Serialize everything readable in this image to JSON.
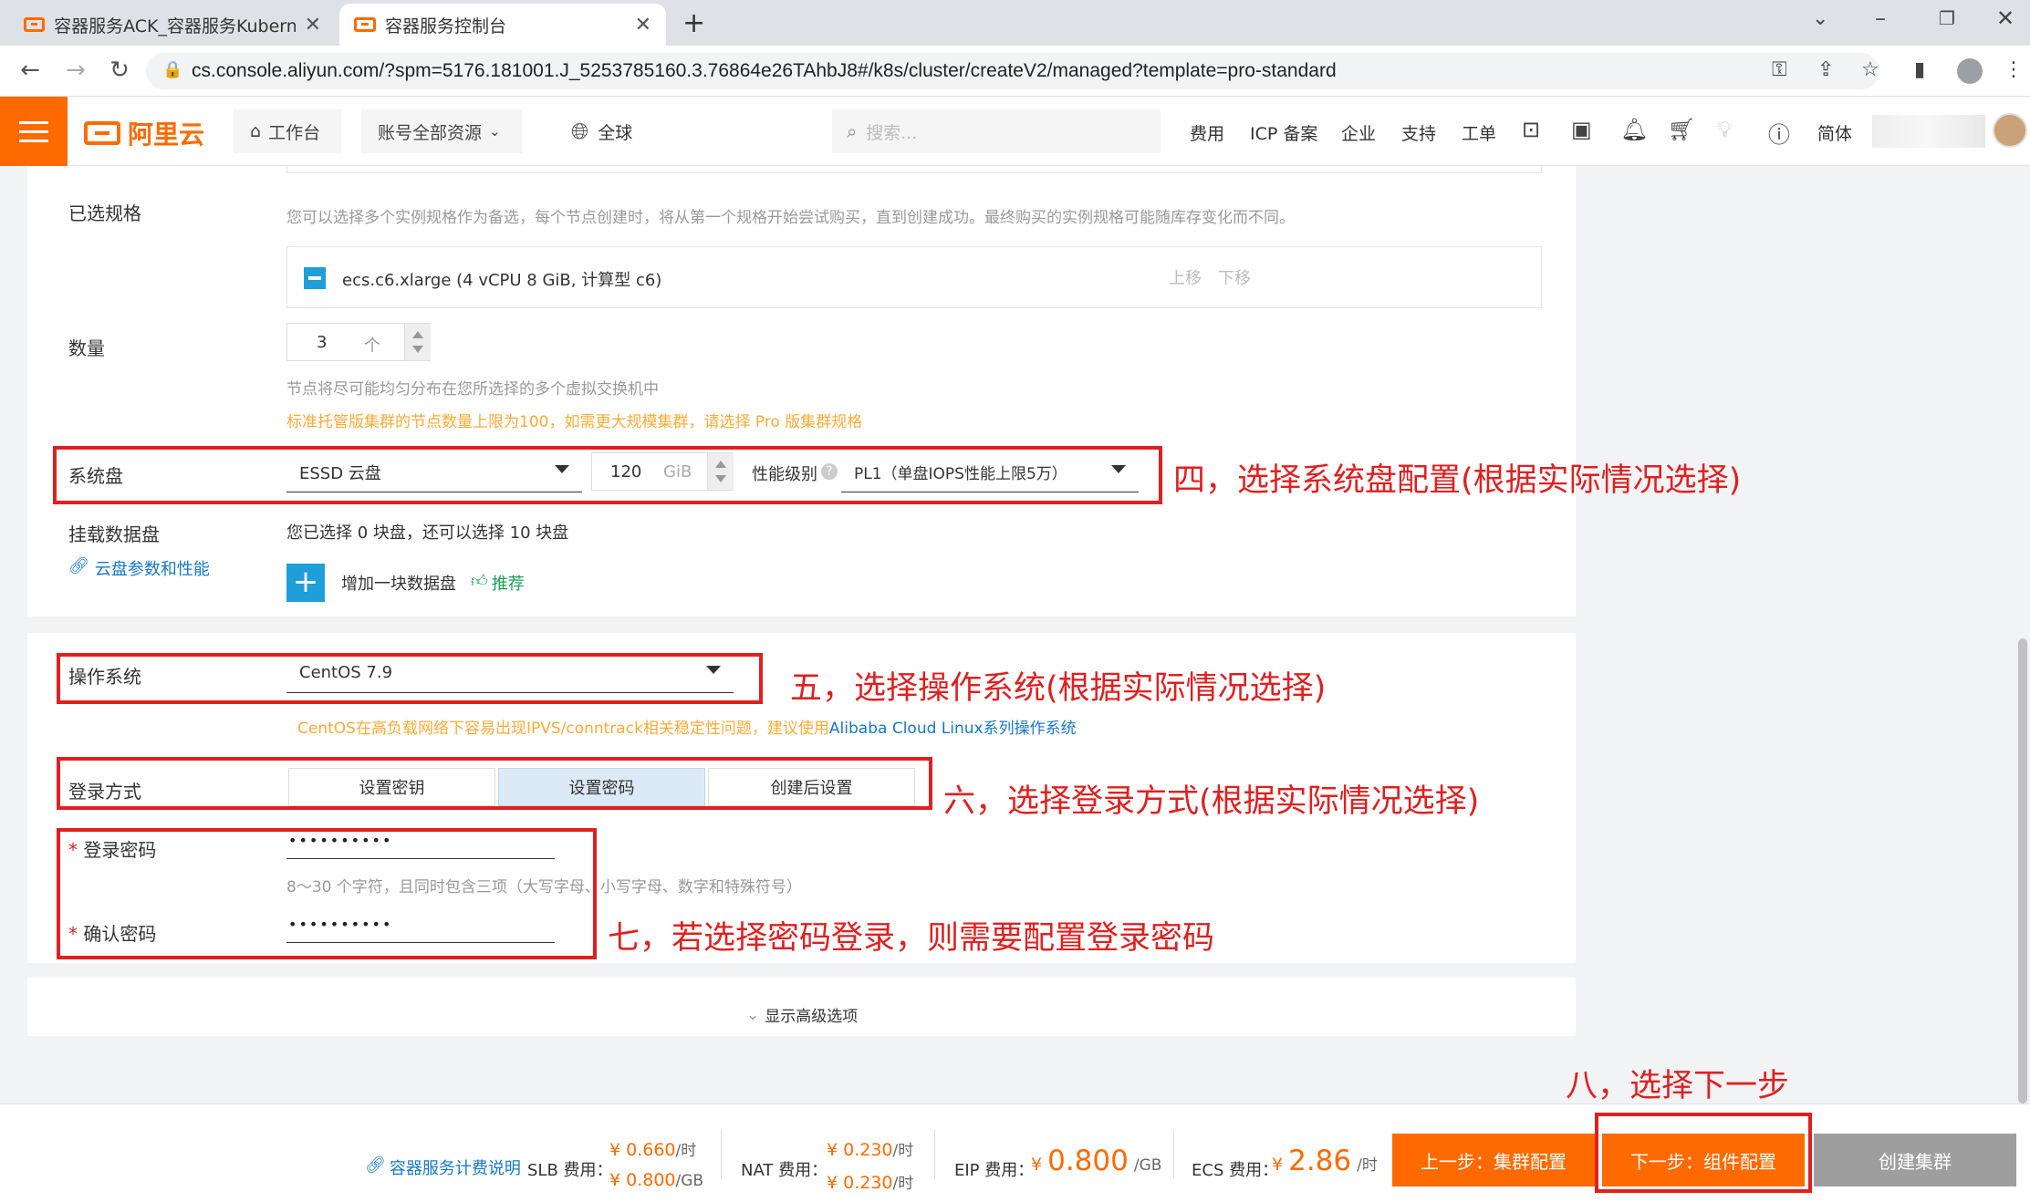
{
  "browser": {
    "tabs": [
      {
        "title": "容器服务ACK_容器服务Kuberne"
      },
      {
        "title": "容器服务控制台"
      }
    ],
    "url": "cs.console.aliyun.com/?spm=5176.181001.J_5253785160.3.76864e26TAhbJ8#/k8s/cluster/createV2/managed?template=pro-standard"
  },
  "topnav": {
    "logo": "阿里云",
    "workbench": "工作台",
    "resources": "账号全部资源",
    "region": "全球",
    "search_placeholder": "搜索...",
    "links": [
      "费用",
      "ICP 备案",
      "企业",
      "支持",
      "工单"
    ],
    "lang": "简体"
  },
  "form": {
    "selected_spec": {
      "label": "已选规格",
      "hint": "您可以选择多个实例规格作为备选，每个节点创建时，将从第一个规格开始尝试购买，直到创建成功。最终购买的实例规格可能随库存变化而不同。",
      "item": "ecs.c6.xlarge (4 vCPU 8 GiB, 计算型 c6)",
      "move_up": "上移",
      "move_down": "下移"
    },
    "quantity": {
      "label": "数量",
      "value": "3",
      "unit": "个",
      "hint": "节点将尽可能均匀分布在您所选择的多个虚拟交换机中",
      "warn": "标准托管版集群的节点数量上限为100，如需更大规模集群，请选择 Pro 版集群规格"
    },
    "system_disk": {
      "label": "系统盘",
      "type": "ESSD 云盘",
      "size": "120",
      "size_unit": "GiB",
      "perf_label": "性能级别",
      "perf_value": "PL1（单盘IOPS性能上限5万）"
    },
    "data_disk": {
      "label": "挂载数据盘",
      "link": "云盘参数和性能",
      "hint": "您已选择 0 块盘，还可以选择 10 块盘",
      "add": "增加一块数据盘",
      "recommend": "推荐"
    },
    "os": {
      "label": "操作系统",
      "value": "CentOS 7.9",
      "warn": "CentOS在高负载网络下容易出现IPVS/conntrack相关稳定性问题，建议使用",
      "warn_link": "Alibaba Cloud Linux系列操作系统"
    },
    "login": {
      "label": "登录方式",
      "options": [
        "设置密钥",
        "设置密码",
        "创建后设置"
      ],
      "selected": "设置密码"
    },
    "password": {
      "label": "登录密码",
      "value": "••••••••••",
      "hint": "8～30 个字符，且同时包含三项（大写字母、小写字母、数字和特殊符号）",
      "confirm_label": "确认密码",
      "confirm_value": "••••••••••"
    },
    "advanced": "显示高级选项"
  },
  "annotations": {
    "a4": "四，选择系统盘配置(根据实际情况选择)",
    "a5": "五，选择操作系统(根据实际情况选择)",
    "a6": "六，选择登录方式(根据实际情况选择)",
    "a7": "七，若选择密码登录，则需要配置登录密码",
    "a8": "八，选择下一步"
  },
  "footer": {
    "billing_link": "容器服务计费说明",
    "slb": {
      "label": "SLB 费用：",
      "v1": "¥ 0.660",
      "u1": "/时",
      "v2": "¥ 0.800",
      "u2": "/GB"
    },
    "nat": {
      "label": "NAT 费用：",
      "v1": "¥ 0.230",
      "u1": "/时",
      "v2": "¥ 0.230",
      "u2": "/时"
    },
    "eip": {
      "label": "EIP 费用：",
      "currency": "¥",
      "value": "0.800",
      "unit": "/GB"
    },
    "ecs": {
      "label": "ECS 费用：",
      "currency": "¥",
      "value": "2.86",
      "unit": "/时"
    },
    "prev": "上一步：集群配置",
    "next": "下一步：组件配置",
    "create": "创建集群"
  },
  "colors": {
    "brand": "#ff6a00",
    "annotation": "#e02020",
    "link": "#1677cc"
  }
}
